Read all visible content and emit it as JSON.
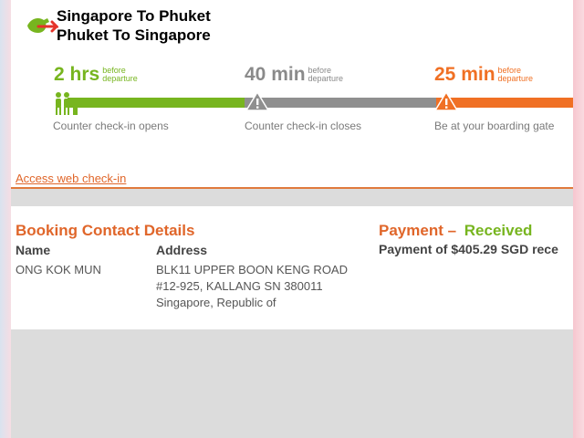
{
  "route": {
    "outbound": "Singapore To Phuket",
    "inbound": "Phuket To Singapore",
    "logo_icon": "red-green-flight-arrow-icon"
  },
  "timeline": {
    "steps": [
      {
        "time": "2 hrs",
        "sub1": "before",
        "sub2": "departure",
        "caption": "Counter check-in  opens",
        "color": "#77b51f",
        "icon": "people-queue-icon"
      },
      {
        "time": "40 min",
        "sub1": "before",
        "sub2": "departure",
        "caption": "Counter check-in closes",
        "color": "#8a8a8a",
        "icon": "warning-icon"
      },
      {
        "time": "25 min",
        "sub1": "before",
        "sub2": "departure",
        "caption": "Be at your boarding gate",
        "color": "#f07024",
        "icon": "warning-icon"
      }
    ]
  },
  "links": {
    "web_checkin": "Access web check-in"
  },
  "booking": {
    "title": "Booking Contact Details",
    "name_label": "Name",
    "address_label": "Address",
    "name_value": "ONG KOK MUN",
    "address_line1": "BLK11 UPPER BOON KENG ROAD",
    "address_line2": "#12-925, KALLANG SN 380011",
    "address_line3": "Singapore, Republic of"
  },
  "payment": {
    "title_prefix": "Payment –",
    "status": "Received",
    "line": "Payment of $405.29 SGD rece"
  },
  "colors": {
    "accent_orange": "#e0662a",
    "green": "#77b51f",
    "gray": "#8a8a8a"
  }
}
